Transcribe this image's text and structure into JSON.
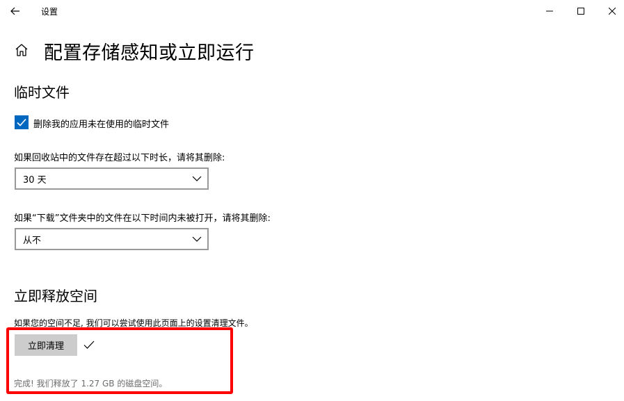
{
  "window": {
    "app_title": "设置",
    "icons": {
      "back": "back-arrow-icon",
      "minimize": "minimize-icon",
      "maximize": "maximize-icon",
      "close": "close-icon"
    }
  },
  "page": {
    "title": "配置存储感知或立即运行",
    "home_icon": "home-icon"
  },
  "temp_files": {
    "section_title": "临时文件",
    "checkbox_label": "删除我的应用未在使用的临时文件",
    "checkbox_checked": true,
    "recycle_label": "如果回收站中的文件存在超过以下时长，请将其删除:",
    "recycle_value": "30 天",
    "downloads_label": "如果“下载”文件夹中的文件在以下时间内未被打开，请将其删除:",
    "downloads_value": "从不"
  },
  "free_space": {
    "section_title": "立即释放空间",
    "description": "如果您的空间不足, 我们可以尝试使用此页面上的设置清理文件。",
    "clean_button": "立即清理",
    "status": "完成! 我们释放了 1.27 GB 的磁盘空间。"
  },
  "colors": {
    "accent": "#0067c0",
    "highlight": "#ff0000",
    "button_bg": "#cccccc",
    "status_text": "#6d6d6d"
  }
}
